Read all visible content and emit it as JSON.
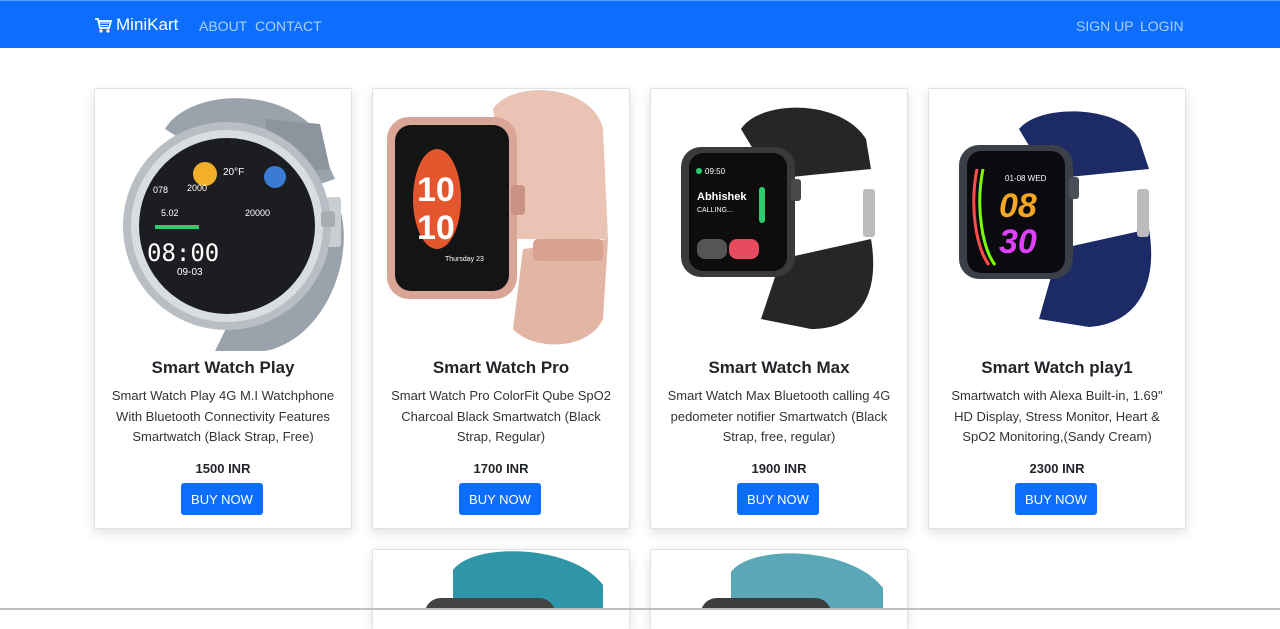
{
  "nav": {
    "brand": "MiniKart",
    "links": [
      "ABOUT",
      "CONTACT"
    ],
    "auth": [
      "SIGN UP",
      "LOGIN"
    ]
  },
  "products": [
    {
      "title": "Smart Watch Play",
      "description": "Smart Watch Play 4G M.I Watchphone With Bluetooth Connectivity Features Smartwatch (Black Strap, Free)",
      "price": "1500 INR",
      "button": "BUY NOW",
      "image": {
        "name": "round-silver-smartwatch",
        "strap": "#9aa3ab",
        "screen": {
          "time": "08:00",
          "date": "09-03",
          "temp": "20°F",
          "s1": "078",
          "s2": "2000",
          "s3": "5.02",
          "s4": "20000"
        }
      }
    },
    {
      "title": "Smart Watch Pro",
      "description": "Smart Watch Pro ColorFit Qube SpO2 Charcoal Black Smartwatch (Black Strap, Regular)",
      "price": "1700 INR",
      "button": "BUY NOW",
      "image": {
        "name": "rose-gold-smartwatch",
        "strap": "#eac3b5",
        "screen": {
          "h": "10",
          "m": "10",
          "date": "Thursday 23"
        }
      }
    },
    {
      "title": "Smart Watch Max",
      "description": "Smart Watch Max Bluetooth calling 4G pedometer notifier Smartwatch (Black Strap, free, regular)",
      "price": "1900 INR",
      "button": "BUY NOW",
      "image": {
        "name": "black-calling-smartwatch",
        "strap": "#262626",
        "screen": {
          "clock": "09:50",
          "caller": "Abhishek",
          "status": "CALLING..."
        }
      }
    },
    {
      "title": "Smart Watch play1",
      "description": "Smartwatch with Alexa Built-in, 1.69\" HD Display, Stress Monitor, Heart & SpO2 Monitoring,(Sandy Cream)",
      "price": "2300 INR",
      "button": "BUY NOW",
      "image": {
        "name": "navy-smartwatch",
        "strap": "#1c2a66",
        "screen": {
          "h": "08",
          "m": "30",
          "date": "01-08 WED"
        }
      }
    }
  ],
  "colors": {
    "primary": "#0d6efd",
    "teal": "#2e96a8",
    "lightTeal": "#5aa7b8"
  },
  "partial_cards": [
    {
      "name": "teal-smartwatch",
      "strap": "#2e96a8"
    },
    {
      "name": "light-teal-smartwatch",
      "strap": "#5aa7b8"
    }
  ]
}
